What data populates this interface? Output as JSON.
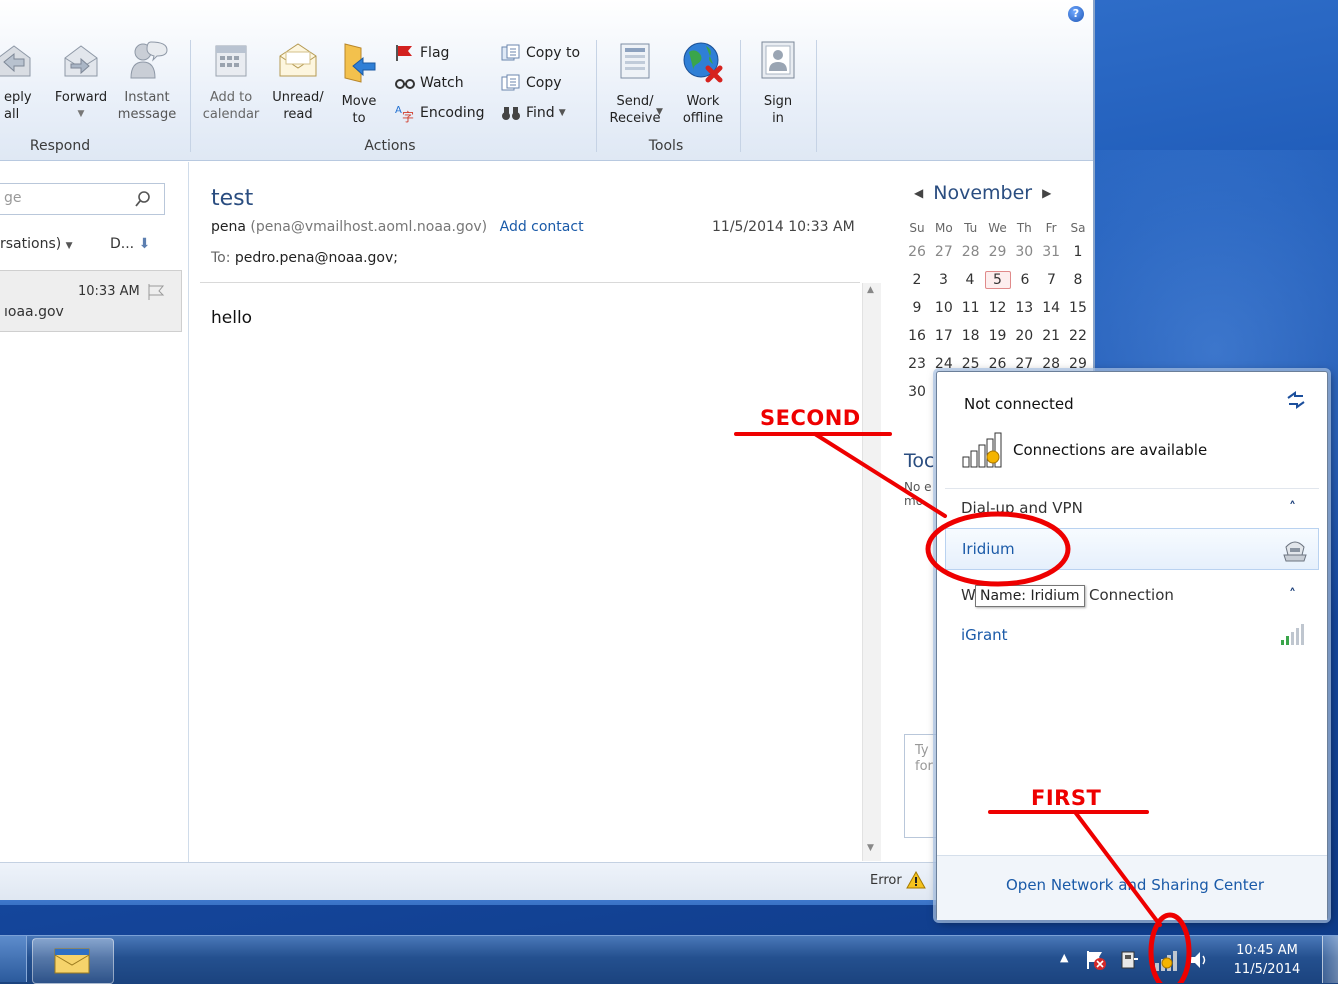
{
  "ribbon": {
    "respond": {
      "reply_all_label": "eply\nall",
      "forward_label": "Forward",
      "instant_message_label": "Instant\nmessage",
      "group_label": "Respond"
    },
    "actions": {
      "add_to_calendar_label": "Add to\ncalendar",
      "unread_read_label": "Unread/\nread",
      "move_to_label": "Move\nto",
      "flag_label": "Flag",
      "watch_label": "Watch",
      "encoding_label": "Encoding",
      "copy_to_label": "Copy to",
      "copy_label": "Copy",
      "find_label": "Find",
      "group_label": "Actions"
    },
    "tools": {
      "send_receive_label": "Send/\nReceive",
      "work_offline_label": "Work\noffline",
      "group_label": "Tools"
    },
    "sign_in_label": "Sign\nin"
  },
  "list_pane": {
    "search_placeholder": "ge",
    "arrange_label": "rsations)",
    "sort_label": "D...",
    "item": {
      "time": "10:33 AM",
      "sender_snippet": "ıoaa.gov"
    }
  },
  "message": {
    "subject": "test",
    "from_name": "pena",
    "from_email": "(pena@vmailhost.aoml.noaa.gov)",
    "add_contact_label": "Add contact",
    "datetime": "11/5/2014 10:33 AM",
    "to_label": "To:",
    "to_value": "pedro.pena@noaa.gov;",
    "body": "hello"
  },
  "calendar": {
    "month": "November",
    "weekdays": [
      "Su",
      "Mo",
      "Tu",
      "We",
      "Th",
      "Fr",
      "Sa"
    ],
    "weeks": [
      [
        "26",
        "27",
        "28",
        "29",
        "30",
        "31",
        "1"
      ],
      [
        "2",
        "3",
        "4",
        "5",
        "6",
        "7",
        "8"
      ],
      [
        "9",
        "10",
        "11",
        "12",
        "13",
        "14",
        "15"
      ],
      [
        "16",
        "17",
        "18",
        "19",
        "20",
        "21",
        "22"
      ],
      [
        "23",
        "24",
        "25",
        "26",
        "27",
        "28",
        "29"
      ],
      [
        "30",
        "",
        "",
        "",
        "",
        "",
        ""
      ]
    ],
    "today": "5",
    "todo_partial": "Toc",
    "todo_note_partial_1": "No e",
    "todo_note_partial_2": "mo",
    "task_input_partial_1": "Ty",
    "task_input_partial_2": "for"
  },
  "status_bar": {
    "error_label": "Error"
  },
  "network_popup": {
    "status": "Not connected",
    "available_text": "Connections are available",
    "section_dialup": "Dial-up and VPN",
    "iridium_label": "Iridium",
    "tooltip": "Name: Iridium",
    "section_wireless_prefix": "W",
    "section_wireless_suffix": "Connection",
    "igrant_label": "iGrant",
    "footer_link": "Open Network and Sharing Center"
  },
  "taskbar": {
    "time": "10:45 AM",
    "date": "11/5/2014"
  },
  "annotations": {
    "first": "FIRST",
    "second": "SECOND",
    "color": "#ee0000"
  }
}
